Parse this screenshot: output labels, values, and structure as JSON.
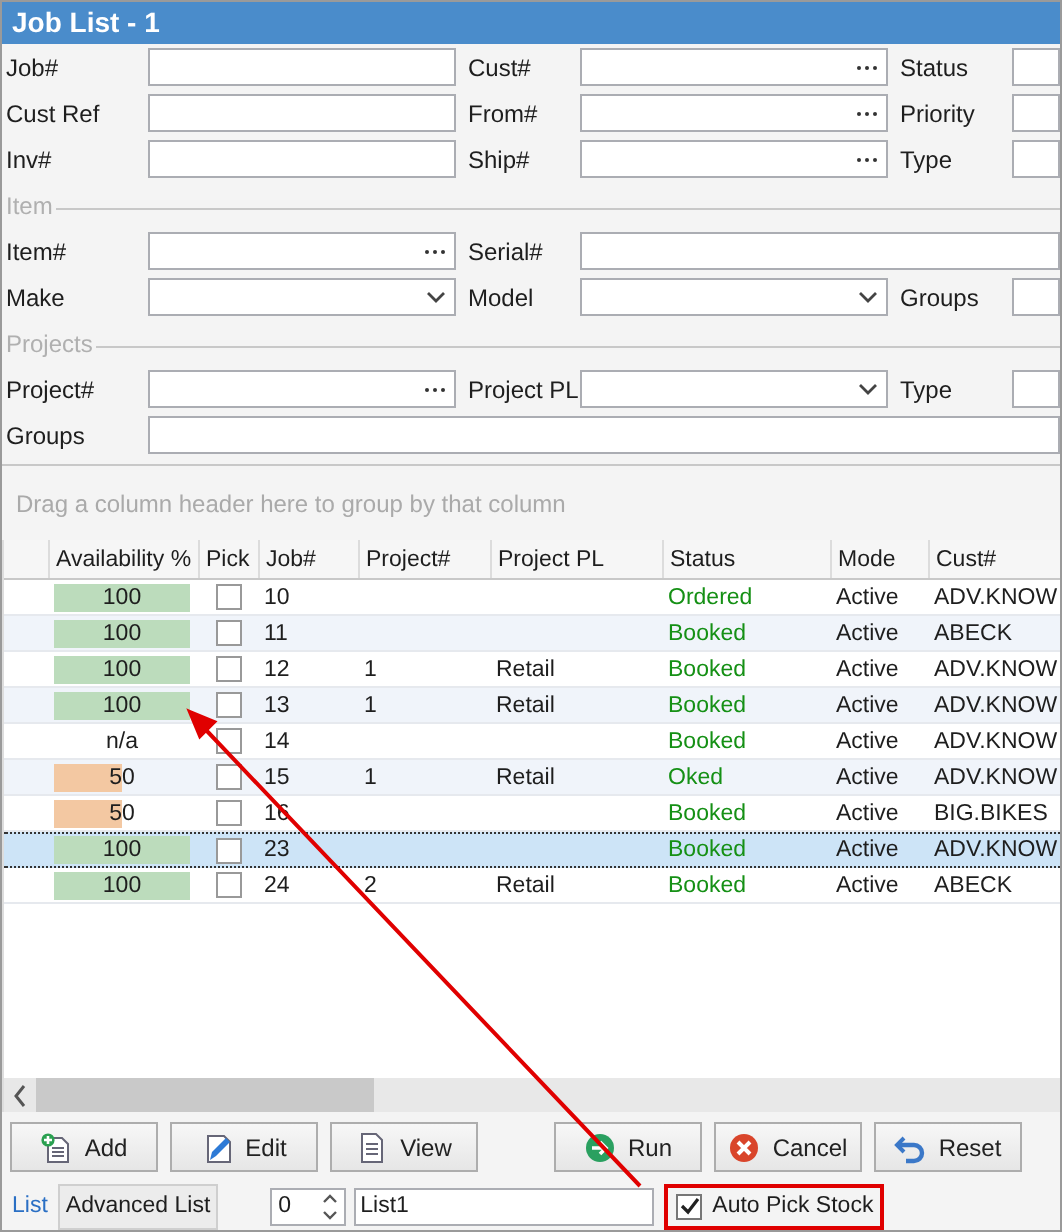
{
  "window": {
    "title": "Job List - 1"
  },
  "filters": [
    {
      "kind": "row",
      "fields": [
        {
          "label": "Job#",
          "kind": "text"
        },
        {
          "label": "Cust#",
          "kind": "lookup"
        },
        {
          "label": "Status",
          "kind": "text"
        }
      ]
    },
    {
      "kind": "row",
      "fields": [
        {
          "label": "Cust Ref",
          "kind": "text"
        },
        {
          "label": "From#",
          "kind": "lookup"
        },
        {
          "label": "Priority",
          "kind": "text"
        }
      ]
    },
    {
      "kind": "row",
      "fields": [
        {
          "label": "Inv#",
          "kind": "text"
        },
        {
          "label": "Ship#",
          "kind": "lookup"
        },
        {
          "label": "Type",
          "kind": "text"
        }
      ]
    },
    {
      "kind": "section",
      "title": "Item"
    },
    {
      "kind": "row",
      "fields": [
        {
          "label": "Item#",
          "kind": "lookup"
        },
        {
          "label": "Serial#",
          "kind": "text"
        }
      ]
    },
    {
      "kind": "row",
      "fields": [
        {
          "label": "Make",
          "kind": "dropdown"
        },
        {
          "label": "Model",
          "kind": "dropdown"
        },
        {
          "label": "Groups",
          "kind": "text"
        }
      ]
    },
    {
      "kind": "section",
      "title": "Projects"
    },
    {
      "kind": "row",
      "fields": [
        {
          "label": "Project#",
          "kind": "lookup"
        },
        {
          "label": "Project PL",
          "kind": "dropdown"
        },
        {
          "label": "Type",
          "kind": "text"
        }
      ]
    },
    {
      "kind": "row",
      "fields": [
        {
          "label": "Groups",
          "kind": "text"
        }
      ]
    }
  ],
  "grid": {
    "group_hint": "Drag a column header here to group by that column",
    "columns": [
      "Availability %",
      "Pick",
      "Job#",
      "Project#",
      "Project PL",
      "Status",
      "Mode",
      "Cust#"
    ],
    "rows": [
      {
        "availability": {
          "text": "100",
          "kind": "full",
          "color": "#bcdcbc"
        },
        "pick": false,
        "job": "10",
        "status": "Ordered",
        "mode": "Active",
        "cust": "ADV.KNOW",
        "selected": false
      },
      {
        "availability": {
          "text": "100",
          "kind": "full",
          "color": "#bcdcbc"
        },
        "pick": false,
        "job": "11",
        "status": "Booked",
        "mode": "Active",
        "cust": "ABECK",
        "selected": false
      },
      {
        "availability": {
          "text": "100",
          "kind": "full",
          "color": "#bcdcbc"
        },
        "pick": false,
        "job": "12",
        "project": "1",
        "project_pl": "Retail",
        "status": "Booked",
        "mode": "Active",
        "cust": "ADV.KNOW",
        "selected": false
      },
      {
        "availability": {
          "text": "100",
          "kind": "full",
          "color": "#bcdcbc"
        },
        "pick": false,
        "job": "13",
        "project": "1",
        "project_pl": "Retail",
        "status": "Booked",
        "mode": "Active",
        "cust": "ADV.KNOW",
        "selected": false
      },
      {
        "availability": {
          "text": "n/a",
          "kind": "none"
        },
        "pick": false,
        "job": "14",
        "status": "Booked",
        "mode": "Active",
        "cust": "ADV.KNOW",
        "selected": false
      },
      {
        "availability": {
          "text": "50",
          "kind": "half",
          "color": "#f3c8a2"
        },
        "pick": false,
        "job": "15",
        "project": "1",
        "project_pl": "Retail",
        "status": "Oked",
        "mode": "Active",
        "cust": "ADV.KNOW",
        "selected": false
      },
      {
        "availability": {
          "text": "50",
          "kind": "half",
          "color": "#f3c8a2"
        },
        "pick": false,
        "job": "16",
        "status": "Booked",
        "mode": "Active",
        "cust": "BIG.BIKES",
        "selected": false
      },
      {
        "availability": {
          "text": "100",
          "kind": "full",
          "color": "#bcdcbc"
        },
        "pick": false,
        "job": "23",
        "status": "Booked",
        "mode": "Active",
        "cust": "ADV.KNOW",
        "selected": true
      },
      {
        "availability": {
          "text": "100",
          "kind": "full",
          "color": "#bcdcbc"
        },
        "pick": false,
        "job": "24",
        "project": "2",
        "project_pl": "Retail",
        "status": "Booked",
        "mode": "Active",
        "cust": "ABECK",
        "selected": false
      }
    ]
  },
  "buttons": [
    {
      "label": "Add"
    },
    {
      "label": "Edit"
    },
    {
      "label": "View"
    },
    {
      "label": "Run"
    },
    {
      "label": "Cancel"
    },
    {
      "label": "Reset"
    }
  ],
  "footer": {
    "tabs": [
      {
        "label": "List",
        "selected": true
      },
      {
        "label": "Advanced List",
        "selected": false
      }
    ],
    "spinner": {
      "value": "0"
    },
    "list_name": {
      "value": "List1"
    },
    "auto_pick": {
      "label": "Auto Pick Stock",
      "checked": true
    }
  }
}
